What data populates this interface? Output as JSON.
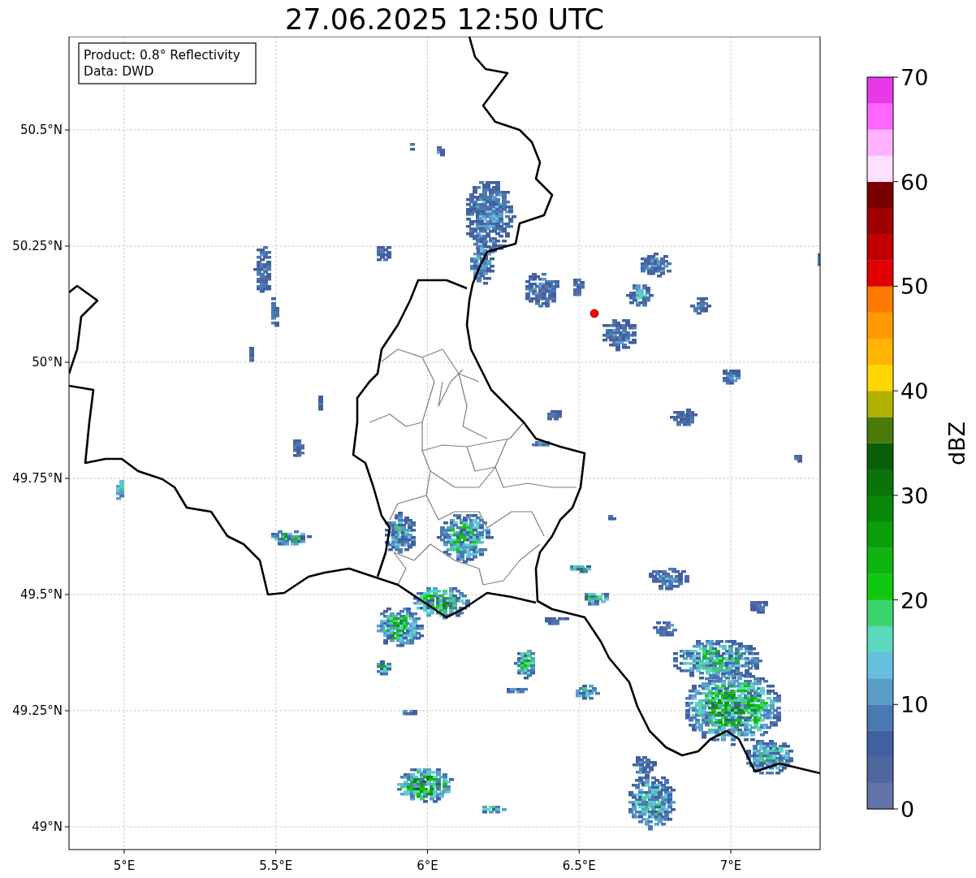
{
  "title": "27.06.2025 12:50 UTC",
  "annotation": [
    "Product: 0.8° Reflectivity",
    "Data: DWD"
  ],
  "map": {
    "lon_ticks": [
      "5°E",
      "5.5°E",
      "6°E",
      "6.5°E",
      "7°E"
    ],
    "lat_ticks": [
      "50.5°N",
      "50.25°N",
      "50°N",
      "49.75°N",
      "49.5°N",
      "49.25°N",
      "49°N"
    ]
  },
  "colorbar": {
    "label": "dBZ",
    "ticks": [
      "70",
      "60",
      "50",
      "40",
      "30",
      "20",
      "10",
      "0"
    ],
    "segments": [
      {
        "color": "#6474a8"
      },
      {
        "color": "#5068a0"
      },
      {
        "color": "#4060a0"
      },
      {
        "color": "#4a7ab4"
      },
      {
        "color": "#5a9ec8"
      },
      {
        "color": "#64c0dc"
      },
      {
        "color": "#5cd8c0"
      },
      {
        "color": "#3cd46c"
      },
      {
        "color": "#10c810"
      },
      {
        "color": "#10b410"
      },
      {
        "color": "#0a9e0a"
      },
      {
        "color": "#0a880a"
      },
      {
        "color": "#0a730a"
      },
      {
        "color": "#0a5e0a"
      },
      {
        "color": "#4a7a0a"
      },
      {
        "color": "#b0b000"
      },
      {
        "color": "#ffd700"
      },
      {
        "color": "#ffb400"
      },
      {
        "color": "#ff9a00"
      },
      {
        "color": "#ff7a00"
      },
      {
        "color": "#e00000"
      },
      {
        "color": "#c00000"
      },
      {
        "color": "#a00000"
      },
      {
        "color": "#7a0000"
      },
      {
        "color": "#ffdfff"
      },
      {
        "color": "#ffb3ff"
      },
      {
        "color": "#ff66ff"
      },
      {
        "color": "#e838e8"
      }
    ]
  }
}
